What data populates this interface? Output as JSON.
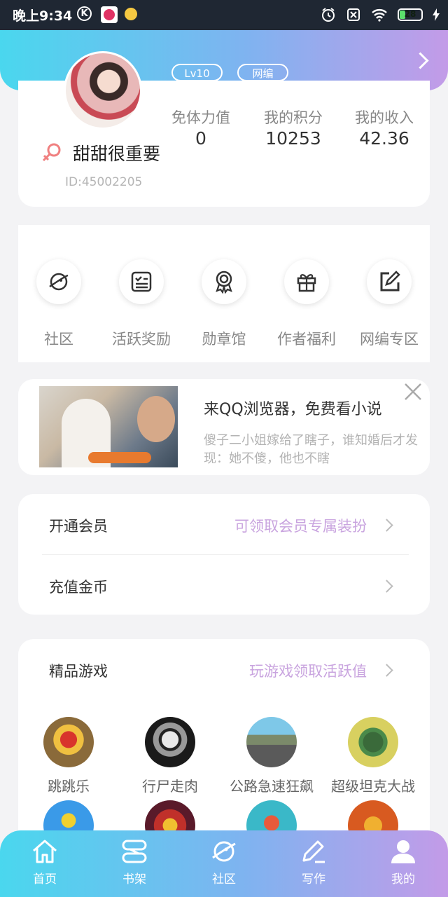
{
  "status_bar": {
    "time": "晚上9:34",
    "k_badge": "K",
    "battery": "28",
    "battery_level": 0.28
  },
  "header": {
    "badges": [
      "Lv10",
      "网编"
    ]
  },
  "profile": {
    "username": "甜甜很重要",
    "user_id": "ID:45002205",
    "stats": [
      {
        "label": "免体力值",
        "value": "0"
      },
      {
        "label": "我的积分",
        "value": "10253"
      },
      {
        "label": "我的收入",
        "value": "42.36"
      }
    ]
  },
  "quick_actions": [
    {
      "label": "社区",
      "icon": "planet-icon"
    },
    {
      "label": "活跃奖励",
      "icon": "checklist-icon"
    },
    {
      "label": "勋章馆",
      "icon": "medal-icon"
    },
    {
      "label": "作者福利",
      "icon": "gift-icon"
    },
    {
      "label": "网编专区",
      "icon": "edit-square-icon"
    }
  ],
  "ad": {
    "title": "来QQ浏览器，免费看小说",
    "description": "傻子二小姐嫁给了瞎子，谁知婚后才发现：她不傻，他也不瞎"
  },
  "membership": {
    "vip_label": "开通会员",
    "vip_hint": "可领取会员专属装扮",
    "recharge_label": "充值金币"
  },
  "games": {
    "title": "精品游戏",
    "hint": "玩游戏领取活跃值",
    "items": [
      {
        "name": "跳跳乐"
      },
      {
        "name": "行尸走肉"
      },
      {
        "name": "公路急速狂飙"
      },
      {
        "name": "超级坦克大战"
      }
    ]
  },
  "nav": [
    {
      "label": "首页",
      "icon": "home-icon"
    },
    {
      "label": "书架",
      "icon": "bookshelf-icon"
    },
    {
      "label": "社区",
      "icon": "planet-icon"
    },
    {
      "label": "写作",
      "icon": "pen-icon"
    },
    {
      "label": "我的",
      "icon": "user-icon"
    }
  ],
  "colors": {
    "accent_start": "#4ad7ee",
    "accent_end": "#c39be8",
    "hint_purple": "#c9a4df",
    "gender_red": "#f08080"
  }
}
